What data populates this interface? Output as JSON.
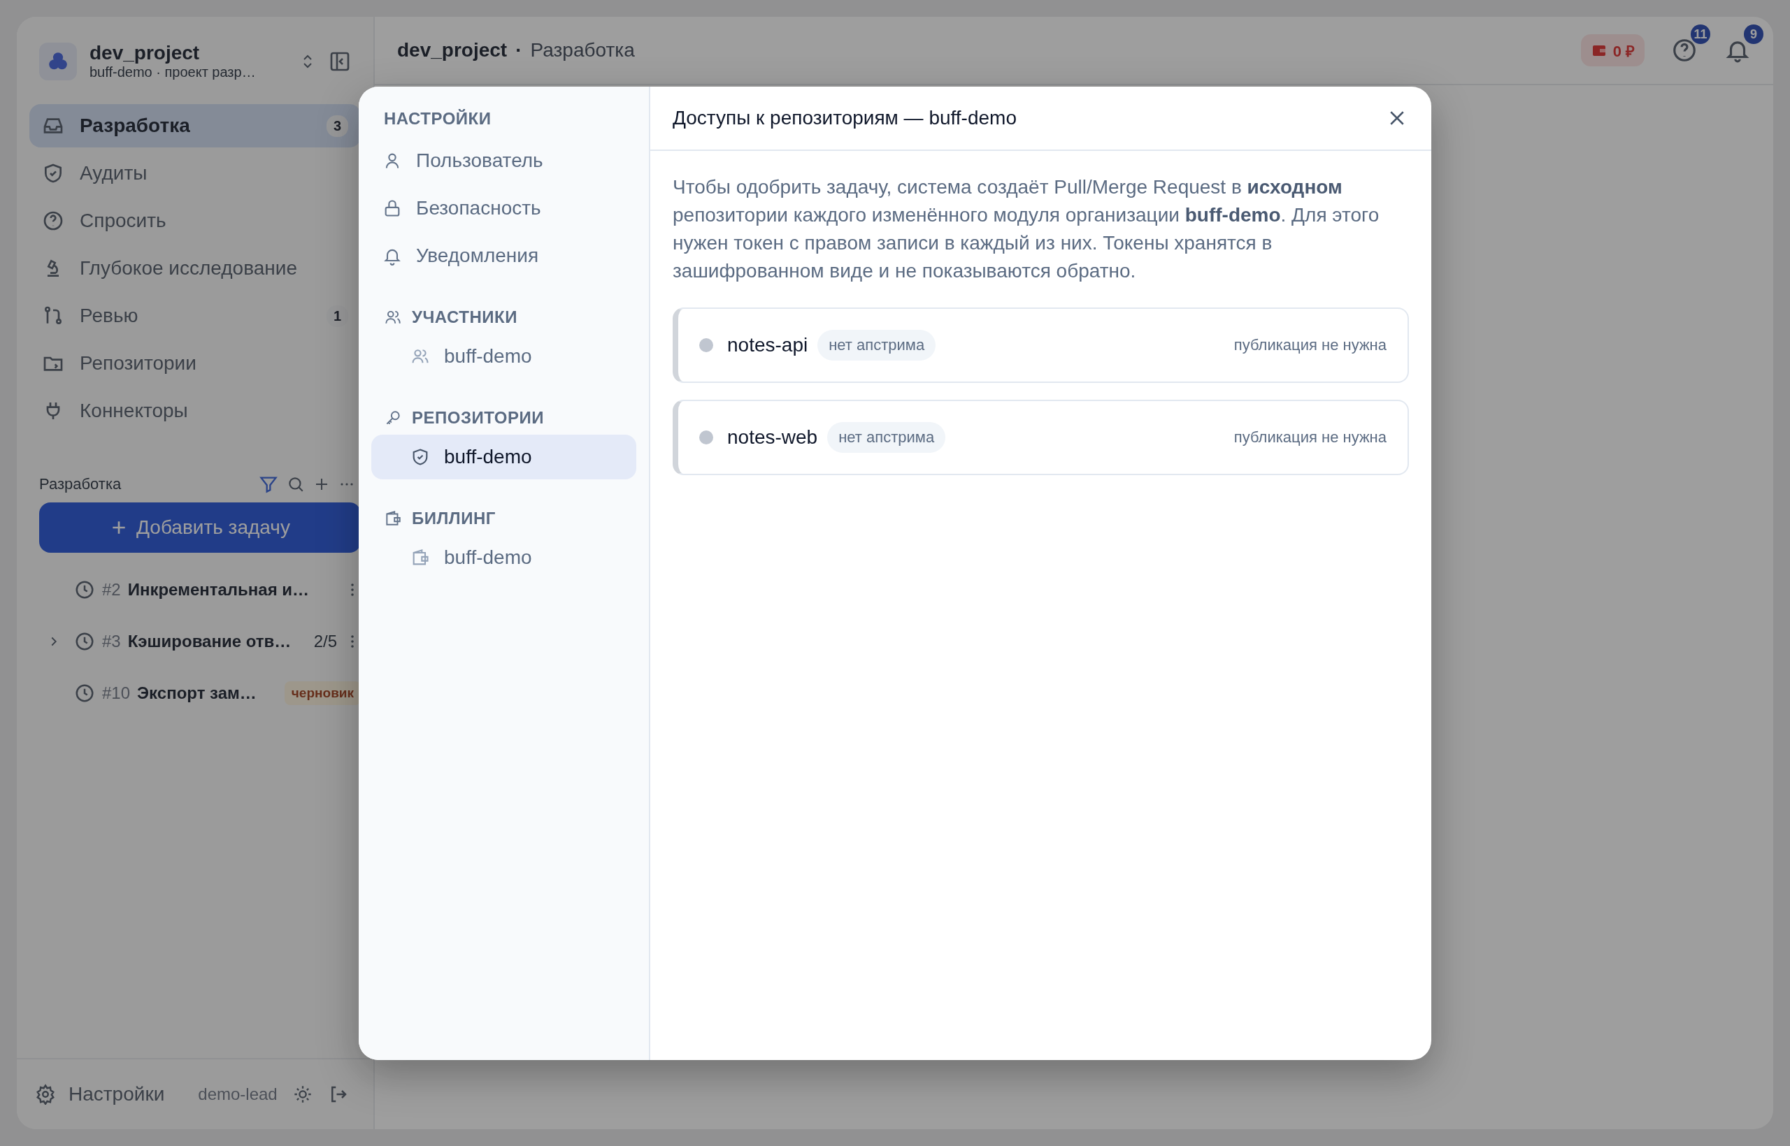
{
  "sidebar": {
    "project": {
      "name": "dev_project",
      "subtitle": "buff-demo · проект разр…"
    },
    "nav": [
      {
        "label": "Разработка",
        "badge": "3",
        "selected": true
      },
      {
        "label": "Аудиты",
        "selected": false
      },
      {
        "label": "Спросить",
        "selected": false
      },
      {
        "label": "Глубокое исследование",
        "selected": false
      },
      {
        "label": "Ревью",
        "badge": "1",
        "selected": false
      },
      {
        "label": "Репозитории",
        "selected": false
      },
      {
        "label": "Коннекторы",
        "selected": false
      }
    ],
    "tasks_title": "Разработка",
    "add_button": "Добавить задачу",
    "tasks": [
      {
        "number": "#2",
        "title": "Инкрементальная и…",
        "has_subtasks": false
      },
      {
        "number": "#3",
        "title": "Кэширование отв…",
        "progress": "2/5",
        "has_subtasks": true
      },
      {
        "number": "#10",
        "title": "Экспорт зам…",
        "tag": "черновик",
        "has_subtasks": false
      }
    ],
    "footer": {
      "settings": "Настройки",
      "user": "demo-lead"
    }
  },
  "header": {
    "breadcrumb": [
      "dev_project",
      "·",
      "Разработка"
    ],
    "balance": "0 ₽",
    "help_badge": "11",
    "notifications_badge": "9"
  },
  "modal": {
    "groups": [
      {
        "heading": "НАСТРОЙКИ",
        "items": [
          {
            "label": "Пользователь",
            "selected": false
          },
          {
            "label": "Безопасность",
            "selected": false
          },
          {
            "label": "Уведомления",
            "selected": false
          }
        ]
      },
      {
        "heading": "УЧАСТНИКИ",
        "items": [
          {
            "label": "buff-demo",
            "selected": false
          }
        ]
      },
      {
        "heading": "РЕПОЗИТОРИИ",
        "items": [
          {
            "label": "buff-demo",
            "selected": true
          }
        ]
      },
      {
        "heading": "БИЛЛИНГ",
        "items": [
          {
            "label": "buff-demo",
            "selected": false
          }
        ]
      }
    ],
    "title": "Доступы к репозиториям — buff-demo",
    "description": "Чтобы одобрить задачу, система создаёт Pull/Merge Request в **исходном** репозитории каждого изменённого модуля организации **buff-demo**. Для этого нужен токен с правом записи в каждый из них. Токены хранятся в зашифрованном виде и не показываются обратно.",
    "repos": [
      {
        "name": "notes-api",
        "tag": "нет апстрима",
        "status": "публикация не нужна",
        "color": "#c0c6d0"
      },
      {
        "name": "notes-web",
        "tag": "нет апстрима",
        "status": "публикация не нужна",
        "color": "#c0c6d0"
      }
    ]
  }
}
